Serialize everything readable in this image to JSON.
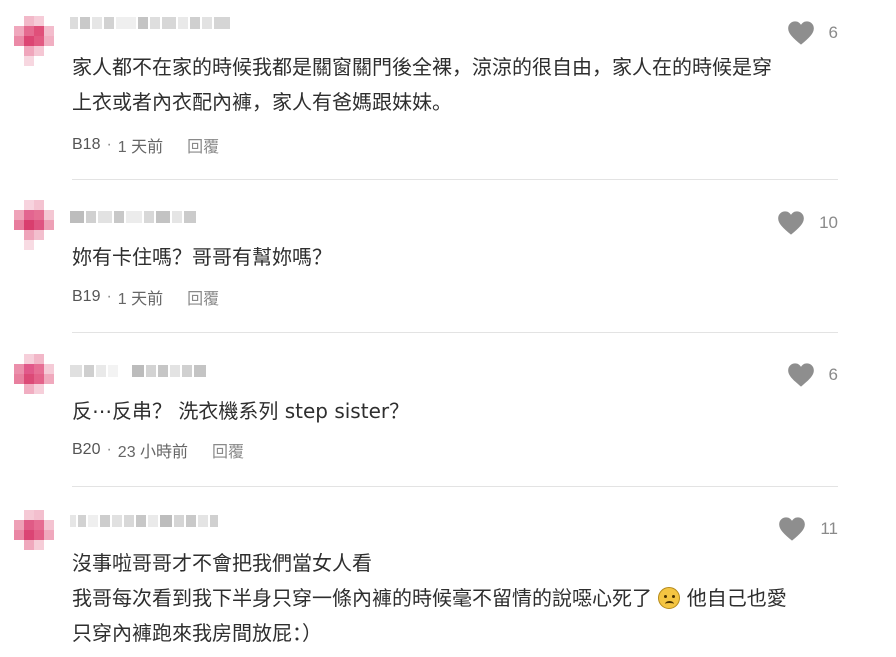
{
  "colors": {
    "heart": "#8e8e8e",
    "avatar_pink": "#e0507a",
    "divider": "#e3e3e3"
  },
  "comments": [
    {
      "likes": "6",
      "lines": [
        "家人都不在家的時候我都是關窗關門後全裸，涼涼的很自由，家人在的時候是穿",
        "上衣或者內衣配內褲，家人有爸媽跟妹妹。"
      ],
      "floor": "B18",
      "time": "1 天前",
      "reply": "回覆"
    },
    {
      "likes": "10",
      "lines": [
        "妳有卡住嗎？哥哥有幫妳嗎？"
      ],
      "floor": "B19",
      "time": "1 天前",
      "reply": "回覆"
    },
    {
      "likes": "6",
      "lines": [
        "反⋯反串？ 洗衣機系列 step sister？"
      ],
      "floor": "B20",
      "time": "23 小時前",
      "reply": "回覆"
    },
    {
      "likes": "11",
      "lines": [
        "沒事啦哥哥才不會把我們當女人看",
        "我哥每次看到我下半身只穿一條內褲的時候毫不留情的說噁心死了",
        "他自己也愛",
        "只穿內褲跑來我房間放屁：）"
      ],
      "emoji": "face-with-open-mouth-emoji"
    }
  ]
}
